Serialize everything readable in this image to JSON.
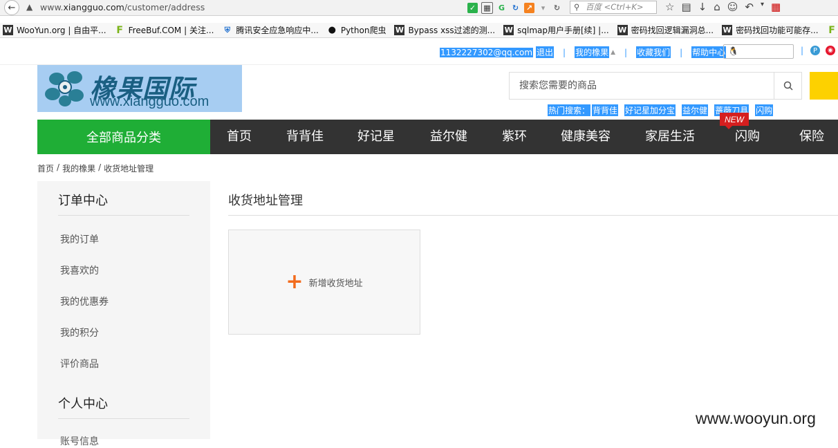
{
  "browser": {
    "url_prefix": "www.",
    "url_host": "xiangguo.com",
    "url_path": "/customer/address",
    "search_placeholder": "百度 <Ctrl+K>"
  },
  "bookmarks": [
    {
      "label": "WooYun.org | 自由平...",
      "icon": "wooyun-icon"
    },
    {
      "label": "FreeBuf.COM | 关注...",
      "icon": "freebuf-icon"
    },
    {
      "label": "腾讯安全应急响应中...",
      "icon": "shield-icon"
    },
    {
      "label": "Python爬虫",
      "icon": "github-icon"
    },
    {
      "label": "Bypass xss过滤的测...",
      "icon": "wooyun-icon"
    },
    {
      "label": "sqlmap用户手册[续] |...",
      "icon": "wooyun-icon"
    },
    {
      "label": "密码找回逻辑漏洞总...",
      "icon": "wooyun-icon"
    },
    {
      "label": "密码找回功能可能存...",
      "icon": "wooyun-icon"
    }
  ],
  "topbar": {
    "email": "1132227302@qq.com",
    "logout": "退出",
    "my_xiangguo": "我的橡果",
    "favorite": "收藏我们",
    "help": "帮助中心"
  },
  "logo": {
    "cn": "橡果国际",
    "en": "www.xiangguo.com"
  },
  "search": {
    "placeholder": "搜索您需要的商品"
  },
  "hot_search": {
    "label": "热门搜索：",
    "items": [
      "背背佳",
      "好记星加分宝",
      "益尔健",
      "蔷薇刀具",
      "闪购"
    ]
  },
  "nav": {
    "all_categories": "全部商品分类",
    "items": [
      "首页",
      "背背佳",
      "好记星",
      "益尔健",
      "紫环",
      "健康美容",
      "家居生活",
      "闪购",
      "保险"
    ],
    "badge": "NEW"
  },
  "breadcrumb": [
    "首页",
    "/",
    "我的橡果",
    "/",
    "收货地址管理"
  ],
  "sidebar": {
    "order_center": "订单中心",
    "order_items": [
      "我的订单",
      "我喜欢的",
      "我的优惠券",
      "我的积分",
      "评价商品"
    ],
    "personal_center": "个人中心",
    "personal_items": [
      "账号信息"
    ]
  },
  "main": {
    "title": "收货地址管理",
    "add_address": "新增收货地址"
  },
  "watermark": "www.wooyun.org",
  "colors": {
    "nav_bg": "#333333",
    "nav_all_bg": "#1fae36",
    "accent_plus": "#f26b1d",
    "selection_highlight": "#3399ff",
    "yellow_button": "#fdd100"
  }
}
